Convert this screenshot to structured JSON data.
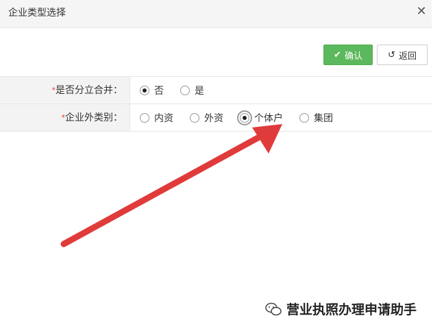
{
  "dialog": {
    "title": "企业类型选择"
  },
  "toolbar": {
    "confirm_label": "确认",
    "back_label": "返回"
  },
  "form": {
    "rows": [
      {
        "label": "是否分立合并：",
        "options": [
          {
            "label": "否",
            "checked": true
          },
          {
            "label": "是",
            "checked": false
          }
        ]
      },
      {
        "label": "企业外类别：",
        "options": [
          {
            "label": "内资",
            "checked": false
          },
          {
            "label": "外资",
            "checked": false
          },
          {
            "label": "个体户",
            "checked": true
          },
          {
            "label": "集团",
            "checked": false
          }
        ]
      }
    ]
  },
  "watermark": {
    "text": "营业执照办理申请助手"
  },
  "colors": {
    "confirm": "#5cb85c",
    "arrow": "#e03b3b",
    "required": "#e23b3b"
  }
}
